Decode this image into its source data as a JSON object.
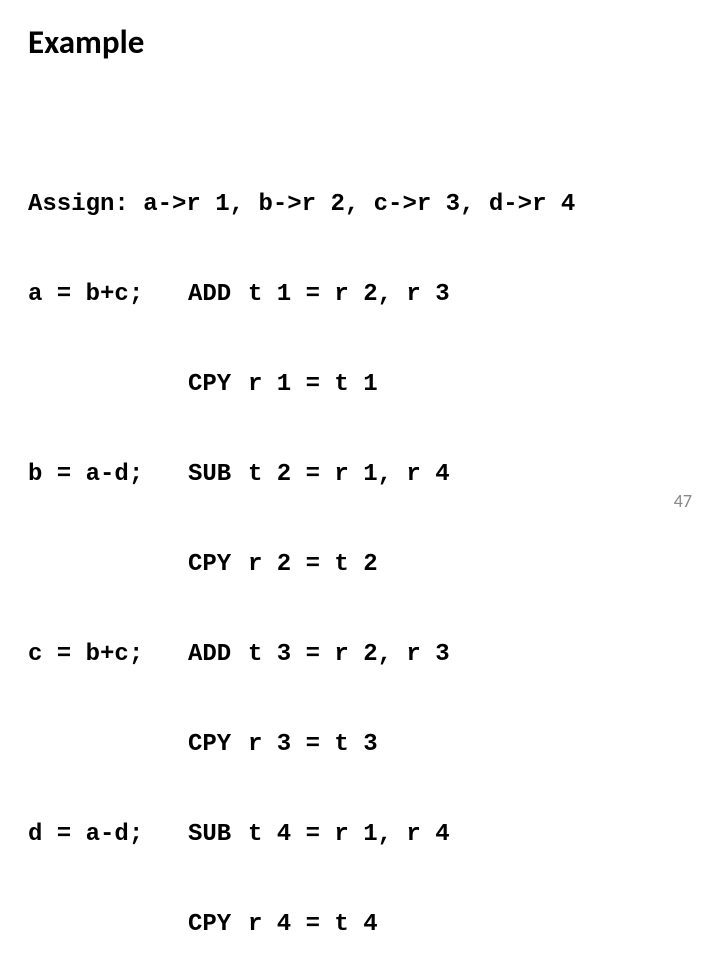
{
  "title": "Example",
  "page_number": "47",
  "code": {
    "assign_line": "Assign: a->r 1, b->r 2, c->r 3, d->r 4",
    "rows": [
      {
        "src": "a = b+c;",
        "op": "ADD",
        "body": "t 1 = r 2, r 3"
      },
      {
        "src": "",
        "op": "CPY",
        "body": "r 1 = t 1"
      },
      {
        "src": "b = a-d;",
        "op": "SUB",
        "body": "t 2 = r 1, r 4"
      },
      {
        "src": "",
        "op": "CPY",
        "body": "r 2 = t 2"
      },
      {
        "src": "c = b+c;",
        "op": "ADD",
        "body": "t 3 = r 2, r 3"
      },
      {
        "src": "",
        "op": "CPY",
        "body": "r 3 = t 3"
      },
      {
        "src": "d = a-d;",
        "op": "SUB",
        "body": "t 4 = r 1, r 4"
      },
      {
        "src": "",
        "op": "CPY",
        "body": "r 4 = t 4"
      }
    ]
  }
}
